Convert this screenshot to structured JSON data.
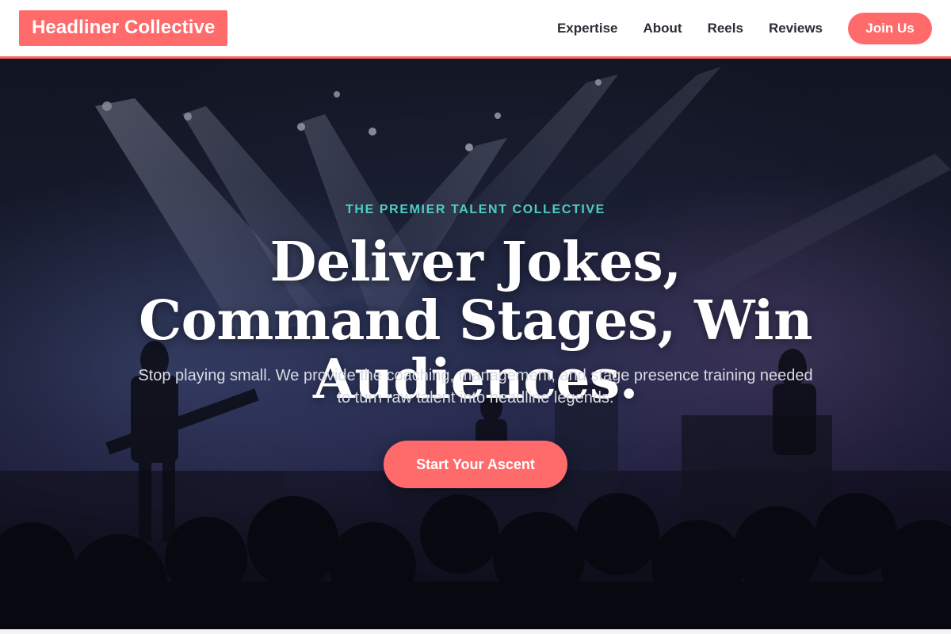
{
  "header": {
    "brand": "Headliner Collective",
    "nav": [
      "Expertise",
      "About",
      "Reels",
      "Reviews"
    ],
    "cta_label": "Join Us"
  },
  "hero": {
    "eyebrow": "THE PREMIER TALENT COLLECTIVE",
    "headline": "Deliver Jokes, Command Stages, Win Audiences.",
    "subtext": "Stop playing small. We provide the coaching, management, and stage presence training needed to turn raw talent into headline legends.",
    "cta_label": "Start Your Ascent"
  },
  "colors": {
    "accent": "#ff6b6b",
    "eyebrow": "#4ecdc4",
    "nav_text": "#2a2d34"
  }
}
